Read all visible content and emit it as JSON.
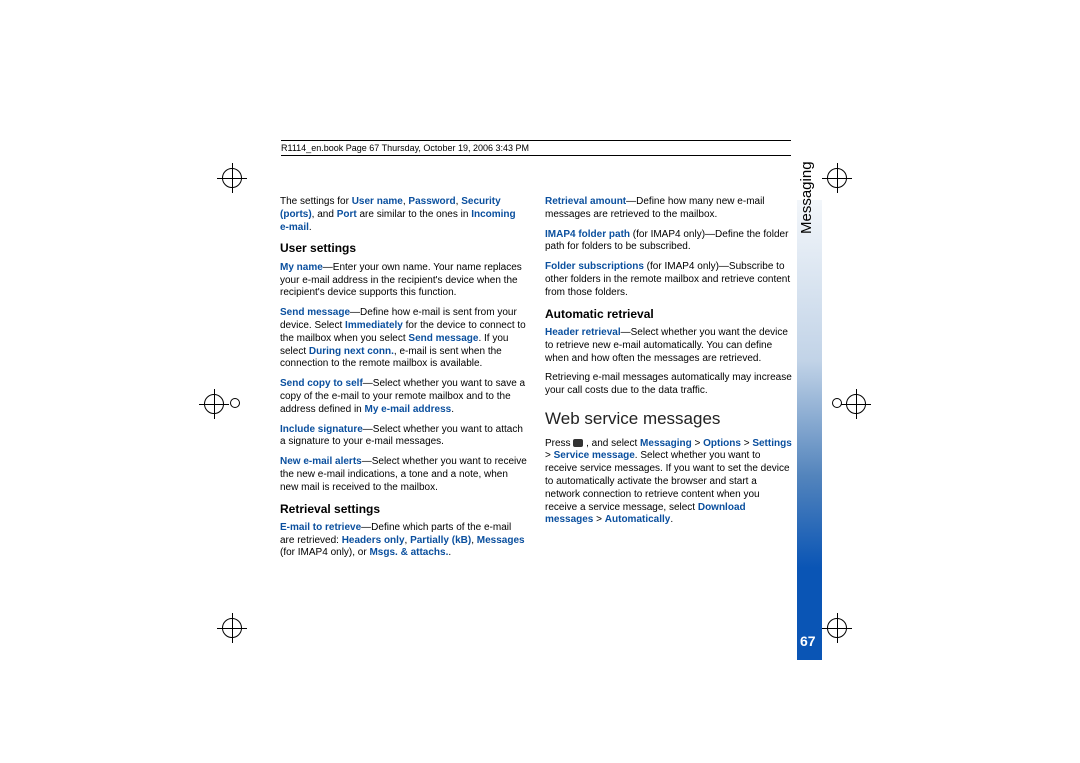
{
  "header": {
    "text": "R1114_en.book  Page 67  Thursday, October 19, 2006  3:43 PM"
  },
  "sidebar": {
    "label": "Messaging",
    "page_number": "67"
  },
  "col_left": {
    "intro_1": "The settings for ",
    "intro_username": "User name",
    "intro_comma1": ", ",
    "intro_password": "Password",
    "intro_comma2": ", ",
    "intro_security": "Security (ports)",
    "intro_comma3": ", and ",
    "intro_port": "Port",
    "intro_2": " are similar to the ones in ",
    "intro_incoming": "Incoming e-mail",
    "intro_3": ".",
    "h_user": "User settings",
    "myname_term": "My name",
    "myname_text": "—Enter your own name. Your name replaces your e-mail address in the recipient's device when the recipient's device supports this function.",
    "sendmsg_term": "Send message",
    "sendmsg_text1": "—Define how e-mail is sent from your device. Select ",
    "sendmsg_imm": "Immediately",
    "sendmsg_text2": " for the device to connect to the mailbox when you select ",
    "sendmsg_sm": "Send message",
    "sendmsg_text3": ". If you select ",
    "sendmsg_dnc": "During next conn.",
    "sendmsg_text4": ", e-mail is sent when the connection to the remote mailbox is available.",
    "sendcopy_term": "Send copy to self",
    "sendcopy_text1": "—Select whether you want to save a copy of the e-mail to your remote mailbox and to the address defined in ",
    "sendcopy_addr": "My e-mail address",
    "sendcopy_text2": ".",
    "sig_term": "Include signature",
    "sig_text": "—Select whether you want to attach a signature to your e-mail messages.",
    "alerts_term": "New e-mail alerts",
    "alerts_text": "—Select whether you want to receive the new e-mail indications, a tone and a note, when new mail is received to the mailbox.",
    "h_retrieval": "Retrieval settings",
    "email_term": "E-mail to retrieve",
    "email_text1": "—Define which parts of the e-mail are retrieved: ",
    "email_headers": "Headers only",
    "email_c1": ", ",
    "email_partial": "Partially (kB)",
    "email_c2": ", ",
    "email_msgs": "Messages",
    "email_text2": " (for IMAP4 only), or ",
    "email_attach": "Msgs. & attachs.",
    "email_text3": "."
  },
  "col_right": {
    "ramount_term": "Retrieval amount",
    "ramount_text": "—Define how many new e-mail messages are retrieved to the mailbox.",
    "imap_term": "IMAP4 folder path",
    "imap_text": " (for IMAP4 only)—Define the folder path for folders to be subscribed.",
    "folder_term": "Folder subscriptions",
    "folder_text": " (for IMAP4 only)—Subscribe to other folders in the remote mailbox and retrieve content from those folders.",
    "h_auto": "Automatic retrieval",
    "header_term": "Header retrieval",
    "header_text": "—Select whether you want the device to retrieve new e-mail automatically. You can define when and how often the messages are retrieved.",
    "auto_note": "Retrieving e-mail messages automatically may increase your call costs due to the data traffic.",
    "h_web": "Web service messages",
    "web_text1": "Press ",
    "web_text2": " , and select ",
    "web_msg": "Messaging",
    "web_gt1": " > ",
    "web_opt": "Options",
    "web_gt2": " > ",
    "web_set": "Settings",
    "web_gt3": " > ",
    "web_sm": "Service message",
    "web_text3": ". Select whether you want to receive service messages. If you want to set the device to automatically activate the browser and start a network connection to retrieve content when you receive a service message, select ",
    "web_dl": "Download messages",
    "web_gt4": " > ",
    "web_auto": "Automatically",
    "web_text4": "."
  }
}
